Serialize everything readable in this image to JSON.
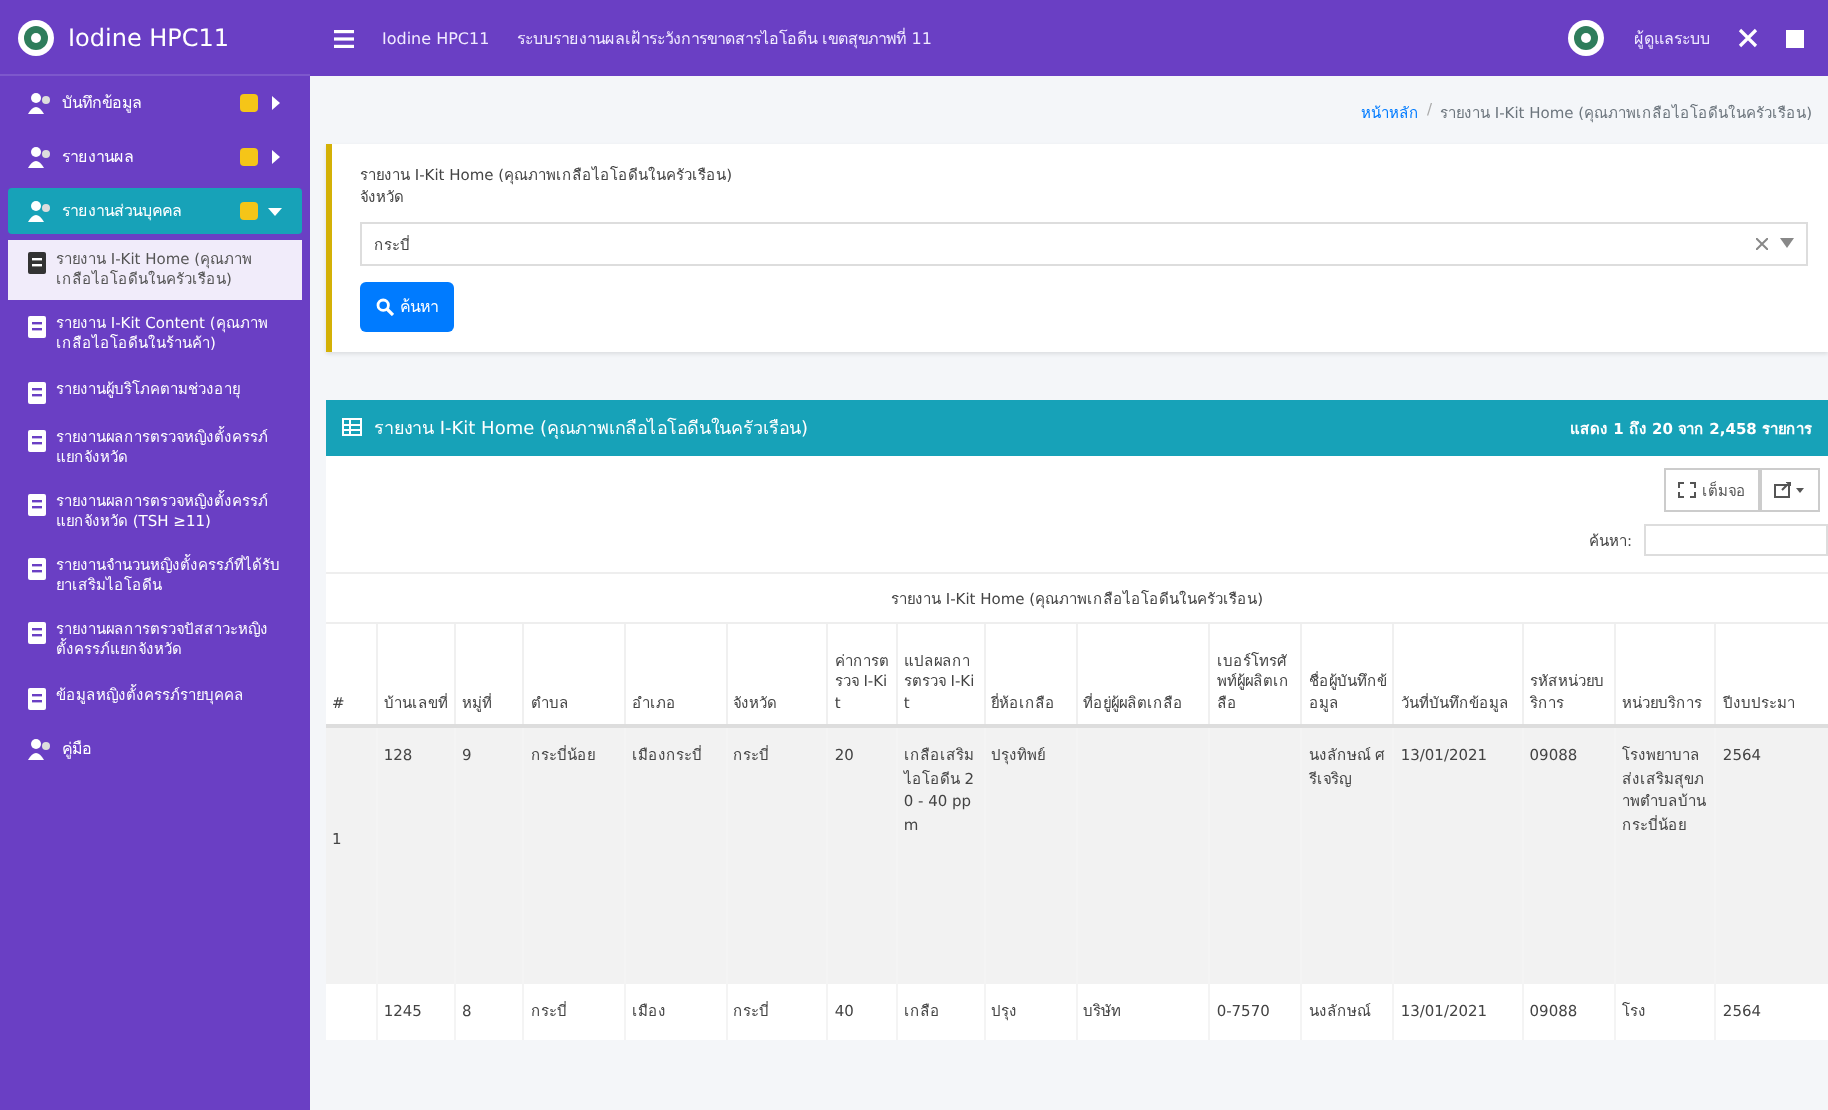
{
  "topbar": {
    "brand": "Iodine HPC11",
    "app_name": "Iodine HPC11",
    "page_title": "ระบบรายงานผลเฝ้าระวังการขาดสารไอโอดีน เขตสุขภาพที่ 11",
    "user_name": "ผู้ดูแลระบบ"
  },
  "sidebar": {
    "items": [
      {
        "label": "บันทึกข้อมูล",
        "kind": "group",
        "expanded": false,
        "selected": false
      },
      {
        "label": "รายงานผล",
        "kind": "group",
        "expanded": false,
        "selected": false
      },
      {
        "label": "รายงานส่วนบุคคล",
        "kind": "group",
        "expanded": true,
        "selected": true,
        "children": [
          {
            "label": "รายงาน I-Kit Home (คุณภาพเกลือไอโอดีนในครัวเรือน)",
            "selected": true
          },
          {
            "label": "รายงาน I-Kit Content (คุณภาพเกลือไอโอดีนในร้านค้า)",
            "selected": false
          },
          {
            "label": "รายงานผู้บริโภคตามช่วงอายุ",
            "selected": false
          },
          {
            "label": "รายงานผลการตรวจหญิงตั้งครรภ์แยกจังหวัด",
            "selected": false
          },
          {
            "label": "รายงานผลการตรวจหญิงตั้งครรภ์แยกจังหวัด (TSH ≥11)",
            "selected": false
          },
          {
            "label": "รายงานจำนวนหญิงตั้งครรภ์ที่ได้รับยาเสริมไอโอดีน",
            "selected": false
          },
          {
            "label": "รายงานผลการตรวจปัสสาวะหญิงตั้งครรภ์แยกจังหวัด",
            "selected": false
          },
          {
            "label": "ข้อมูลหญิงตั้งครรภ์รายบุคคล",
            "selected": false
          }
        ]
      },
      {
        "label": "คู่มือ",
        "kind": "link",
        "selected": false
      }
    ]
  },
  "breadcrumb": {
    "separator": "/",
    "items": [
      "หน้าหลัก",
      "รายงาน I-Kit Home (คุณภาพเกลือไอโอดีนในครัวเรือน)"
    ]
  },
  "filter": {
    "title": "รายงาน I-Kit Home (คุณภาพเกลือไอโอดีนในครัวเรือน)",
    "field_label": "จังหวัด",
    "value": "กระบี่",
    "search_button": "ค้นหา"
  },
  "report": {
    "title": "รายงาน I-Kit Home (คุณภาพเกลือไอโอดีนในครัวเรือน)",
    "summary": "แสดง 1 ถึง 20 จาก 2,458 รายการ",
    "fullscreen_button": "เต็มจอ",
    "search_label": "ค้นหา:",
    "caption": "รายงาน I-Kit Home (คุณภาพเกลือไอโอดีนในครัวเรือน)",
    "table": {
      "columns": [
        "#",
        "บ้านเลขที่",
        "หมู่ที่",
        "ตำบล",
        "อำเภอ",
        "จังหวัด",
        "ค่าการตรวจ I-Kit",
        "แปลผลการตรวจ I-Kit",
        "ยี่ห้อเกลือ",
        "ที่อยู่ผู้ผลิตเกลือ",
        "เบอร์โทรศัพท์ผู้ผลิตเกลือ",
        "ชื่อผู้บันทึกข้อมูล",
        "วันที่บันทึกข้อมูล",
        "รหัสหน่วยบริการ",
        "หน่วยบริการ",
        "ปีงบประมา"
      ],
      "rows": [
        [
          "1",
          "128",
          "9",
          "กระบี่น้อย",
          "เมืองกระบี่",
          "กระบี่",
          "20",
          "เกลือเสริมไอโอดีน 20 - 40 ppm",
          "ปรุงทิพย์",
          "",
          "",
          "นงลักษณ์ ศรีเจริญ",
          "13/01/2021",
          "09088",
          "โรงพยาบาลส่งเสริมสุขภาพตำบลบ้านกระบี่น้อย",
          "2564"
        ],
        [
          "",
          "1245",
          "8",
          "กระบี่",
          "เมือง",
          "กระบี่",
          "40",
          "เกลือ",
          "ปรุง",
          "บริษัท",
          "0-7570",
          "นงลักษณ์",
          "13/01/2021",
          "09088",
          "โรง",
          "2564"
        ]
      ]
    }
  }
}
